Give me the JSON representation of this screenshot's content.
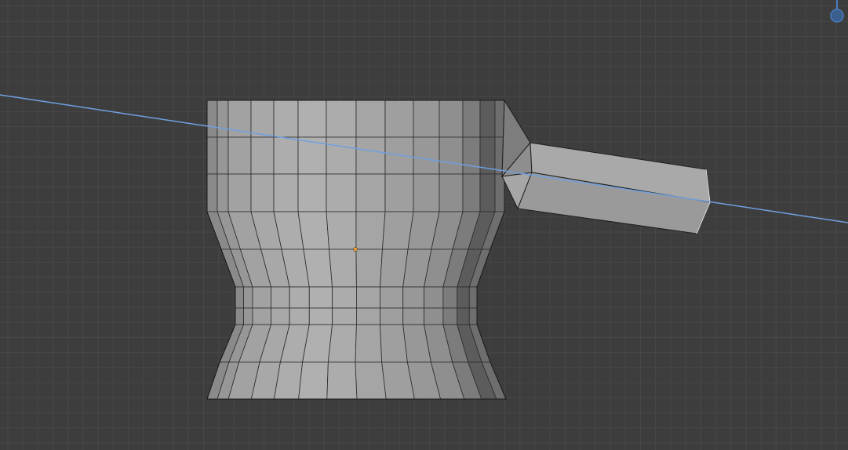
{
  "viewport": {
    "colors": {
      "background": "#3d3d3d",
      "grid": "#474747",
      "mesh_edge": "#1e1e1e",
      "axis_line": "#6fa0e0",
      "origin": "#f0a030",
      "gizmo": "#4a7cc0"
    }
  }
}
